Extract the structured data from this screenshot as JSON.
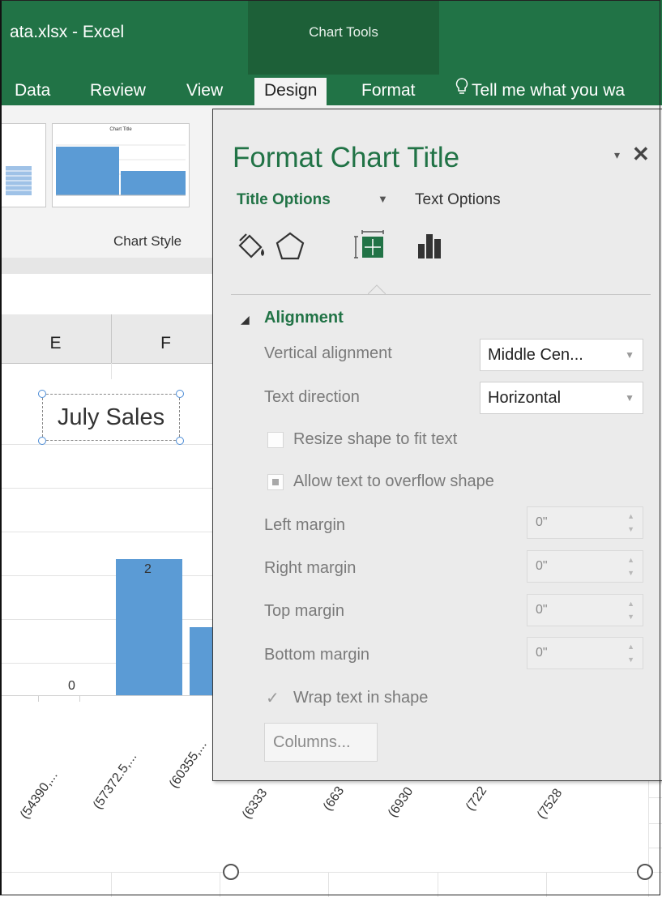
{
  "window": {
    "title": "ata.xlsx - Excel",
    "context_group": "Chart Tools"
  },
  "ribbon": {
    "tabs": [
      {
        "label": "Data"
      },
      {
        "label": "Review"
      },
      {
        "label": "View"
      },
      {
        "label": "Design"
      },
      {
        "label": "Format"
      }
    ],
    "active_tab": "Design",
    "tell_me": "Tell me what you wa",
    "gallery_label": "Chart Style",
    "thumbnail_title": "Chart Title"
  },
  "sheet": {
    "columns": [
      "E",
      "F"
    ]
  },
  "chart": {
    "title": "July Sales",
    "data_labels": [
      "0",
      "2"
    ],
    "tick_labels": [
      "(54390,...",
      "(57372.5,...",
      "(60355,...",
      "(6333",
      "(663",
      "(6930",
      "(722",
      "(7528"
    ]
  },
  "chart_data": {
    "type": "bar",
    "title": "July Sales",
    "categories": [
      "(54390,...",
      "(57372.5,...",
      "(60355,...",
      "(6333",
      "(663",
      "(6930",
      "(722",
      "(7528"
    ],
    "values": [
      0,
      2,
      1
    ],
    "ylim": [
      0,
      3
    ]
  },
  "pane": {
    "title": "Format Chart Title",
    "dropdown_glyph": "▾",
    "close_glyph": "✕",
    "tab_title_options": "Title Options",
    "tab_text_options": "Text Options",
    "icons": [
      "fill-line-icon",
      "effects-icon",
      "size-properties-icon",
      "chart-options-icon"
    ],
    "section": "Alignment",
    "vertical_alignment": {
      "label": "Vertical alignment",
      "value": "Middle Cen..."
    },
    "text_direction": {
      "label": "Text direction",
      "value": "Horizontal"
    },
    "resize_shape": {
      "label": "Resize shape to fit text",
      "checked": false
    },
    "allow_overflow": {
      "label": "Allow text to overflow shape",
      "checked": true
    },
    "left_margin": {
      "label": "Left margin",
      "value": "0\""
    },
    "right_margin": {
      "label": "Right margin",
      "value": "0\""
    },
    "top_margin": {
      "label": "Top margin",
      "value": "0\""
    },
    "bottom_margin": {
      "label": "Bottom margin",
      "value": "0\""
    },
    "wrap_text": {
      "label": "Wrap text in shape",
      "checked": true
    },
    "columns_button": "Columns..."
  },
  "colors": {
    "excel_green": "#217346",
    "chart_tools_green": "#1d6038",
    "bar_blue": "#5b9bd5"
  }
}
